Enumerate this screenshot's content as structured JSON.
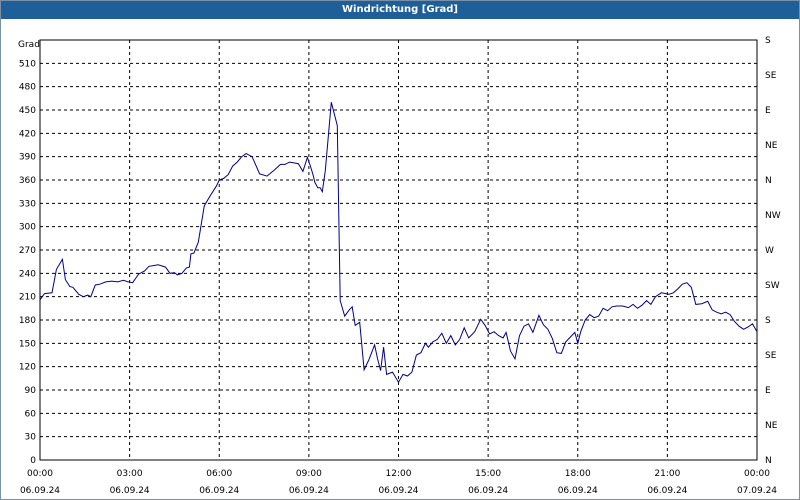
{
  "window": {
    "title": "Windrichtung [Grad]"
  },
  "chart_data": {
    "type": "line",
    "title": "Windrichtung [Grad]",
    "ylabel": "Grad",
    "ylim": [
      0,
      540
    ],
    "y_ticks": [
      0,
      30,
      60,
      90,
      120,
      150,
      180,
      210,
      240,
      270,
      300,
      330,
      360,
      390,
      420,
      450,
      480,
      510
    ],
    "y2_ticks": [
      {
        "value": 0,
        "label": "N"
      },
      {
        "value": 45,
        "label": "NE"
      },
      {
        "value": 90,
        "label": "E"
      },
      {
        "value": 135,
        "label": "SE"
      },
      {
        "value": 180,
        "label": "S"
      },
      {
        "value": 225,
        "label": "SW"
      },
      {
        "value": 270,
        "label": "W"
      },
      {
        "value": 315,
        "label": "NW"
      },
      {
        "value": 360,
        "label": "N"
      },
      {
        "value": 405,
        "label": "NE"
      },
      {
        "value": 450,
        "label": "E"
      },
      {
        "value": 495,
        "label": "SE"
      },
      {
        "value": 540,
        "label": "S"
      }
    ],
    "xlim_hours": [
      0,
      24
    ],
    "x_ticks": [
      {
        "hour": 0,
        "time": "00:00",
        "date": "06.09.24"
      },
      {
        "hour": 3,
        "time": "03:00",
        "date": "06.09.24"
      },
      {
        "hour": 6,
        "time": "06:00",
        "date": "06.09.24"
      },
      {
        "hour": 9,
        "time": "09:00",
        "date": "06.09.24"
      },
      {
        "hour": 12,
        "time": "12:00",
        "date": "06.09.24"
      },
      {
        "hour": 15,
        "time": "15:00",
        "date": "06.09.24"
      },
      {
        "hour": 18,
        "time": "18:00",
        "date": "06.09.24"
      },
      {
        "hour": 21,
        "time": "21:00",
        "date": "06.09.24"
      },
      {
        "hour": 24,
        "time": "00:00",
        "date": "07.09.24"
      }
    ],
    "grid": true,
    "series": [
      {
        "color": "#00008b",
        "x_hours": [
          0,
          0.15,
          0.4,
          0.55,
          0.75,
          0.85,
          1.0,
          1.1,
          1.3,
          1.45,
          1.6,
          1.7,
          1.85,
          2.0,
          2.2,
          2.4,
          2.6,
          2.8,
          2.95,
          3.1,
          3.3,
          3.5,
          3.65,
          3.8,
          3.95,
          4.05,
          4.2,
          4.35,
          4.5,
          4.6,
          4.75,
          4.9,
          5.0,
          5.05,
          5.15,
          5.3,
          5.5,
          5.7,
          5.9,
          6.0,
          6.15,
          6.3,
          6.45,
          6.6,
          6.75,
          6.9,
          7.1,
          7.35,
          7.6,
          7.85,
          8.05,
          8.2,
          8.35,
          8.5,
          8.65,
          8.8,
          8.95,
          9.05,
          9.15,
          9.2,
          9.3,
          9.38,
          9.45,
          9.55,
          9.75,
          9.95,
          10.05,
          10.2,
          10.35,
          10.45,
          10.55,
          10.7,
          10.85,
          11.0,
          11.1,
          11.2,
          11.3,
          11.4,
          11.5,
          11.6,
          11.8,
          12.0,
          12.15,
          12.3,
          12.45,
          12.6,
          12.75,
          12.9,
          13.0,
          13.15,
          13.3,
          13.45,
          13.6,
          13.75,
          13.9,
          14.05,
          14.2,
          14.35,
          14.55,
          14.75,
          14.9,
          15.05,
          15.2,
          15.35,
          15.5,
          15.6,
          15.75,
          15.9,
          16.05,
          16.2,
          16.35,
          16.5,
          16.7,
          16.85,
          17.0,
          17.15,
          17.3,
          17.45,
          17.6,
          17.75,
          17.9,
          18.0,
          18.1,
          18.25,
          18.4,
          18.55,
          18.7,
          18.85,
          19.0,
          19.15,
          19.3,
          19.5,
          19.7,
          19.85,
          20.0,
          20.15,
          20.3,
          20.45,
          20.6,
          20.8,
          20.95,
          21.05,
          21.2,
          21.35,
          21.5,
          21.65,
          21.8,
          21.95,
          22.15,
          22.35,
          22.5,
          22.65,
          22.8,
          22.95,
          23.1,
          23.25,
          23.4,
          23.55,
          23.7,
          23.85,
          24.0
        ],
        "values": [
          206,
          214,
          215,
          245,
          258,
          232,
          223,
          222,
          213,
          210,
          212,
          210,
          225,
          226,
          229,
          230,
          229,
          231,
          229,
          228,
          239,
          243,
          249,
          250,
          251,
          250,
          248,
          240,
          241,
          238,
          240,
          247,
          248,
          265,
          266,
          280,
          327,
          340,
          352,
          360,
          362,
          367,
          378,
          383,
          390,
          394,
          390,
          368,
          365,
          373,
          380,
          380,
          383,
          382,
          381,
          371,
          389,
          378,
          365,
          357,
          350,
          350,
          345,
          372,
          460,
          430,
          205,
          185,
          193,
          197,
          173,
          177,
          116,
          128,
          138,
          148,
          130,
          115,
          145,
          110,
          113,
          100,
          110,
          108,
          113,
          135,
          138,
          150,
          145,
          152,
          155,
          163,
          150,
          160,
          148,
          155,
          170,
          157,
          165,
          181,
          173,
          162,
          165,
          160,
          157,
          164,
          140,
          130,
          160,
          172,
          175,
          164,
          186,
          174,
          168,
          156,
          138,
          137,
          152,
          158,
          164,
          150,
          165,
          180,
          187,
          183,
          185,
          195,
          192,
          197,
          198,
          198,
          196,
          200,
          195,
          199,
          205,
          200,
          210,
          215,
          214,
          213,
          215,
          220,
          226,
          228,
          222,
          200,
          201,
          204,
          193,
          190,
          188,
          190,
          187,
          178,
          172,
          168,
          171,
          175,
          165,
          158,
          165,
          185
        ]
      }
    ]
  }
}
